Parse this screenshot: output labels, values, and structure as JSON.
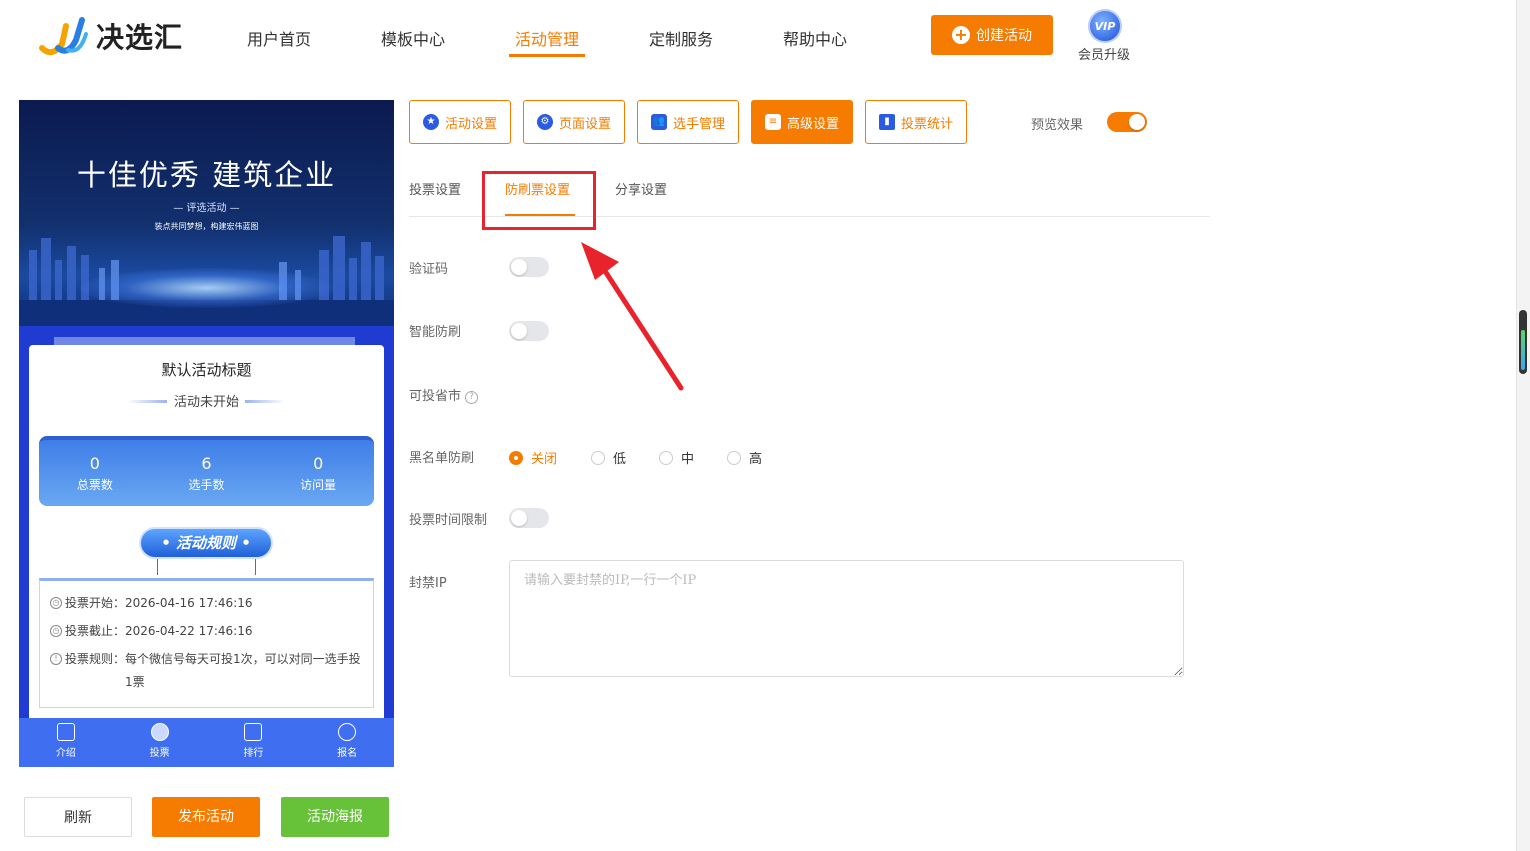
{
  "header": {
    "brand": "决选汇",
    "nav": [
      "用户首页",
      "模板中心",
      "活动管理",
      "定制服务",
      "帮助中心"
    ],
    "active_nav": "活动管理",
    "create_label": "创建活动",
    "vip_badge": "VIP",
    "vip_label": "会员升级"
  },
  "preview": {
    "banner_title": "十佳优秀 建筑企业",
    "banner_sub": "— 评选活动 —",
    "banner_tagline": "装点共同梦想，构建宏伟蓝图",
    "card_title": "默认活动标题",
    "status": "活动未开始",
    "stats": [
      {
        "value": "0",
        "label": "总票数"
      },
      {
        "value": "6",
        "label": "选手数"
      },
      {
        "value": "0",
        "label": "访问量"
      }
    ],
    "rules_title": "• 活动规则 •",
    "rules": [
      {
        "label": "投票开始：",
        "value": "2026-04-16 17:46:16"
      },
      {
        "label": "投票截止：",
        "value": "2026-04-22 17:46:16"
      },
      {
        "label": "投票规则：",
        "value": "每个微信号每天可投1次，可以对同一选手投1票"
      }
    ],
    "tabbar": [
      "介绍",
      "投票",
      "排行",
      "报名"
    ]
  },
  "bottom_buttons": {
    "refresh": "刷新",
    "publish": "发布活动",
    "poster": "活动海报"
  },
  "toolbar": {
    "buttons": [
      "活动设置",
      "页面设置",
      "选手管理",
      "高级设置",
      "投票统计"
    ],
    "active": "高级设置",
    "preview_label": "预览效果",
    "preview_on": true
  },
  "subtabs": {
    "items": [
      "投票设置",
      "防刷票设置",
      "分享设置"
    ],
    "active": "防刷票设置"
  },
  "form": {
    "captcha_label": "验证码",
    "captcha_on": false,
    "smart_label": "智能防刷",
    "smart_on": false,
    "province_label": "可投省市",
    "blacklist_label": "黑名单防刷",
    "blacklist_options": [
      "关闭",
      "低",
      "中",
      "高"
    ],
    "blacklist_selected": "关闭",
    "time_limit_label": "投票时间限制",
    "time_limit_on": false,
    "ip_label": "封禁IP",
    "ip_placeholder": "请输入要封禁的IP,一行一个IP",
    "ip_value": ""
  },
  "colors": {
    "accent": "#f57c00",
    "highlight": "#e8232b",
    "poster_button": "#67c23a"
  }
}
